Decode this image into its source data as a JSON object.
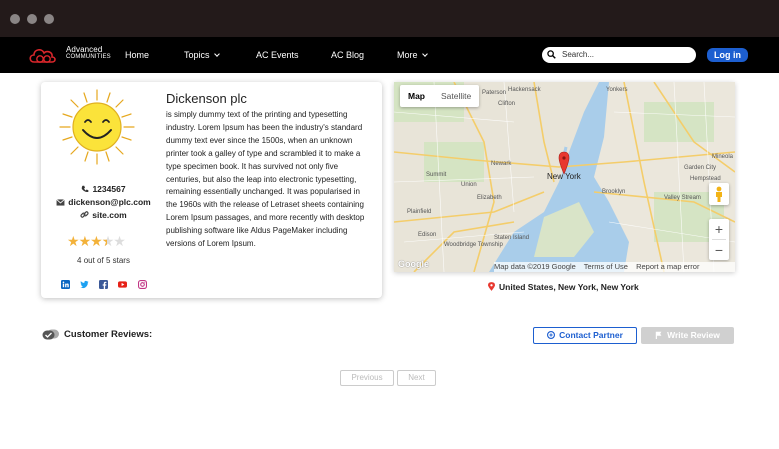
{
  "nav": {
    "logo": {
      "line1": "Advanced",
      "line2": "COMMUNITIES"
    },
    "items": [
      {
        "label": "Home",
        "has_caret": false
      },
      {
        "label": "Topics",
        "has_caret": true
      },
      {
        "label": "AC Events",
        "has_caret": false
      },
      {
        "label": "AC Blog",
        "has_caret": false
      },
      {
        "label": "More",
        "has_caret": true
      }
    ],
    "search_placeholder": "Search...",
    "login_label": "Log in"
  },
  "profile": {
    "company_name": "Dickenson plc",
    "description": "is simply dummy text of the printing and typesetting industry. Lorem Ipsum has been the industry's standard dummy text ever since the 1500s, when an unknown printer took a galley of type and scrambled it to make a type specimen book. It has survived not only five centuries, but also the leap into electronic typesetting, remaining essentially unchanged. It was popularised in the 1960s with the release of Letraset sheets containing Lorem Ipsum passages, and more recently with desktop publishing software like Aldus PageMaker including versions of Lorem Ipsum.",
    "phone": "1234567",
    "email": "dickenson@plc.com",
    "website": "site.com",
    "rating": 3.5,
    "rating_max": 5,
    "rating_text": "4 out of 5 stars",
    "social_icons": [
      "linkedin-icon",
      "twitter-icon",
      "facebook-icon",
      "youtube-icon",
      "instagram-icon"
    ]
  },
  "map": {
    "tabs": [
      "Map",
      "Satellite"
    ],
    "active_tab": "Map",
    "labels": [
      "Hackensack",
      "Clifton",
      "Paterson",
      "Newark",
      "New York",
      "Union",
      "Elizabeth",
      "Summit",
      "Plainfield",
      "Woodbridge Township",
      "Edison",
      "Hempstead",
      "Mineola",
      "Garden City",
      "Valley Stream",
      "Yonkers",
      "Brooklyn",
      "Staten Island"
    ],
    "footer": [
      "Map data ©2019 Google",
      "Terms of Use",
      "Report a map error"
    ],
    "brand": "Google"
  },
  "location_text": "United States, New York, New York",
  "reviews": {
    "title": "Customer Reviews:",
    "contact_label": "Contact Partner",
    "write_label": "Write Review"
  },
  "pagination": {
    "prev": "Previous",
    "next": "Next"
  },
  "colors": {
    "accent": "#1d5fd0",
    "star": "#f3b23a",
    "nav_bg": "#000000",
    "chrome_bg": "#231a1a"
  }
}
